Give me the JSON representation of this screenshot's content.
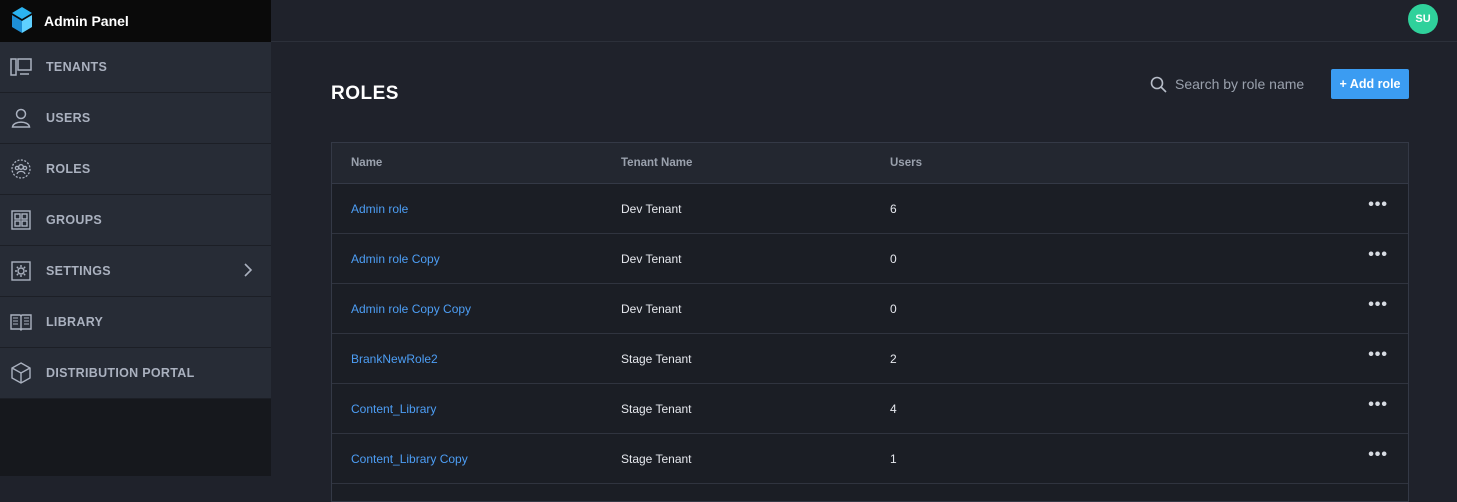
{
  "app": {
    "title": "Admin Panel"
  },
  "user": {
    "initials": "SU"
  },
  "sidebar": {
    "items": [
      {
        "label": "TENANTS",
        "icon": "tenants-icon"
      },
      {
        "label": "USERS",
        "icon": "user-icon"
      },
      {
        "label": "ROLES",
        "icon": "roles-icon"
      },
      {
        "label": "GROUPS",
        "icon": "groups-icon"
      },
      {
        "label": "SETTINGS",
        "icon": "gear-icon"
      },
      {
        "label": "LIBRARY",
        "icon": "book-icon"
      },
      {
        "label": "DISTRIBUTION PORTAL",
        "icon": "box-icon"
      }
    ]
  },
  "page": {
    "title": "ROLES"
  },
  "search": {
    "placeholder": "Search by role name"
  },
  "add_button": {
    "label": "+ Add role"
  },
  "table": {
    "headers": [
      "Name",
      "Tenant Name",
      "Users"
    ],
    "rows": [
      {
        "name": "Admin role",
        "tenant": "Dev Tenant",
        "users": "6"
      },
      {
        "name": "Admin role Copy",
        "tenant": "Dev Tenant",
        "users": "0"
      },
      {
        "name": "Admin role Copy Copy",
        "tenant": "Dev Tenant",
        "users": "0"
      },
      {
        "name": "BrankNewRole2",
        "tenant": "Stage Tenant",
        "users": "2"
      },
      {
        "name": "Content_Library",
        "tenant": "Stage Tenant",
        "users": "4"
      },
      {
        "name": "Content_Library Copy",
        "tenant": "Stage Tenant",
        "users": "1"
      }
    ],
    "row_action": "•••"
  },
  "colors": {
    "accent": "#3b9cf2",
    "link": "#4d9ef5",
    "avatar": "#2fd19b",
    "background": "#1f222b",
    "sidebar": "#272c36"
  }
}
